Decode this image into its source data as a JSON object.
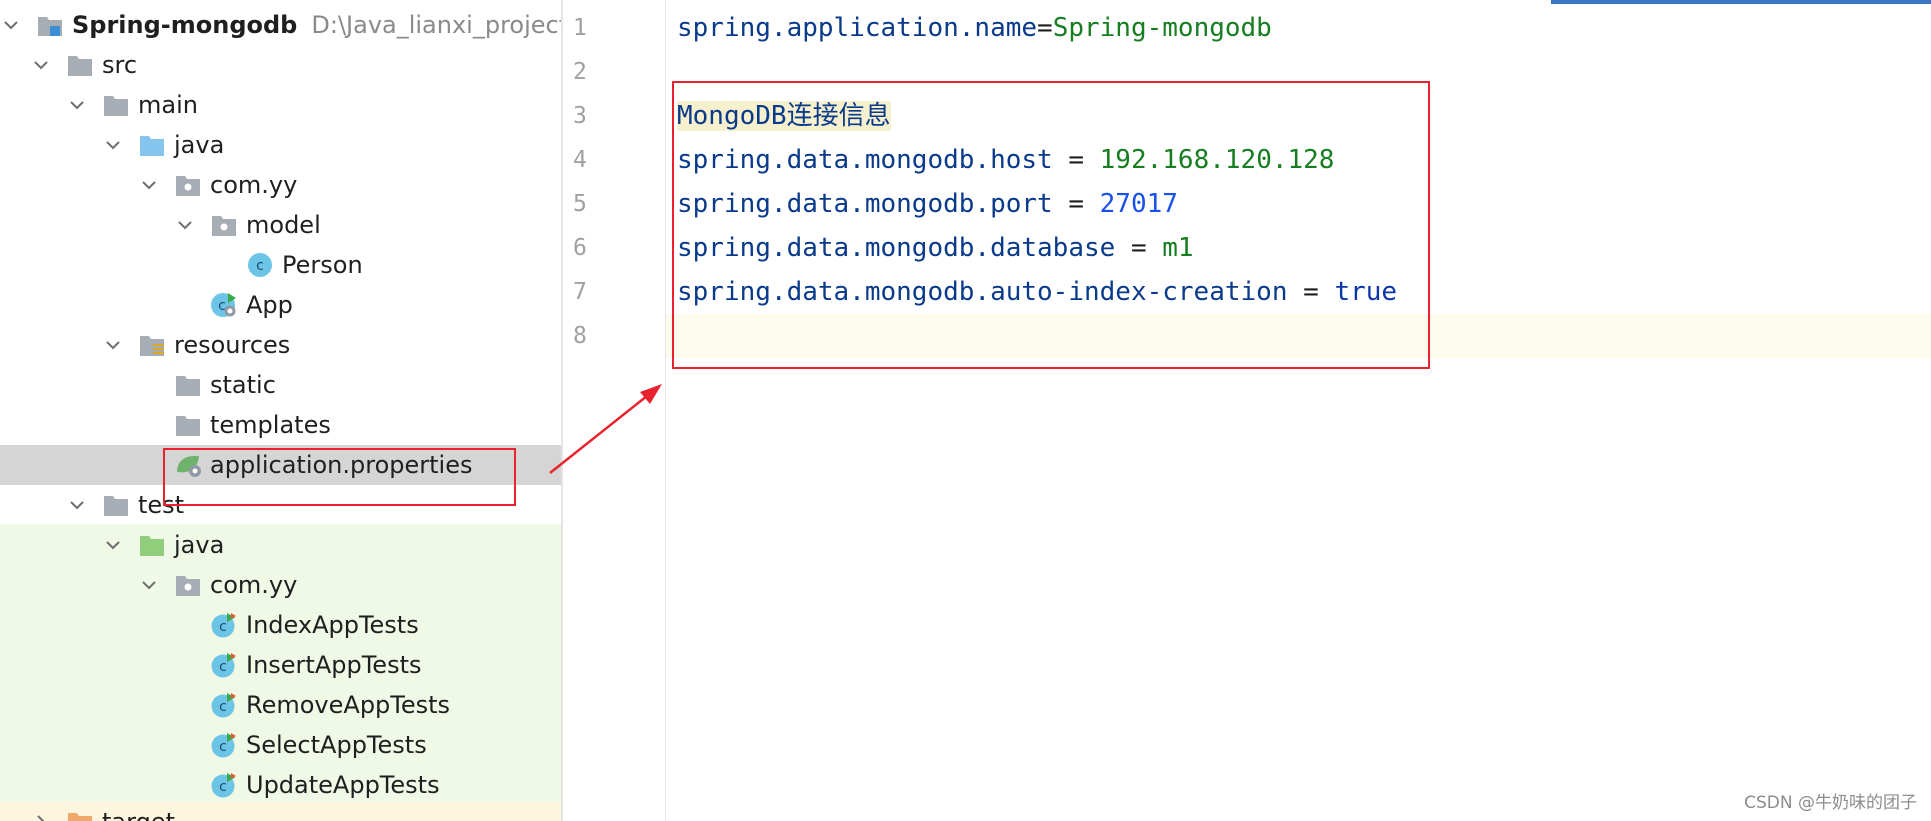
{
  "project_tree": {
    "root": {
      "label": "Spring-mongodb",
      "path": "D:\\Java_lianxi_project\\ni"
    },
    "items": [
      {
        "label": "src"
      },
      {
        "label": "main"
      },
      {
        "label": "java"
      },
      {
        "label": "com.yy"
      },
      {
        "label": "model"
      },
      {
        "label": "Person"
      },
      {
        "label": "App"
      },
      {
        "label": "resources"
      },
      {
        "label": "static"
      },
      {
        "label": "templates"
      },
      {
        "label": "application.properties"
      },
      {
        "label": "test"
      },
      {
        "label": "java"
      },
      {
        "label": "com.yy"
      },
      {
        "label": "IndexAppTests"
      },
      {
        "label": "InsertAppTests"
      },
      {
        "label": "RemoveAppTests"
      },
      {
        "label": "SelectAppTests"
      },
      {
        "label": "UpdateAppTests"
      },
      {
        "label": "target"
      }
    ]
  },
  "editor": {
    "line_numbers": [
      "1",
      "2",
      "3",
      "4",
      "5",
      "6",
      "7",
      "8"
    ],
    "lines": [
      {
        "key": "spring.application.name",
        "sep": "=",
        "value": "Spring-mongodb"
      },
      {
        "text": ""
      },
      {
        "comment": "MongoDB连接信息"
      },
      {
        "key": "spring.data.mongodb.host",
        "sep": " = ",
        "value": "192.168.120.128"
      },
      {
        "key": "spring.data.mongodb.port",
        "sep": " = ",
        "value": "27017"
      },
      {
        "key": "spring.data.mongodb.database",
        "sep": " = ",
        "value": "m1"
      },
      {
        "key": "spring.data.mongodb.auto-index-creation",
        "sep": " = ",
        "value": "true"
      },
      {
        "text": ""
      }
    ]
  },
  "watermark": "CSDN @牛奶味的团子",
  "colors": {
    "selection_bg": "#d5d5d5",
    "test_folder_bg": "#eff9e6",
    "annotation_red": "#e8232e",
    "key_color": "#0a3a8a",
    "string_value_color": "#177d21",
    "number_value_color": "#1750eb"
  },
  "icons": {
    "module": "module-folder-icon",
    "folder": "folder-icon",
    "source_root": "source-root-folder-icon",
    "test_root": "test-root-folder-icon",
    "package": "package-icon",
    "class": "java-class-icon",
    "spring_app": "spring-boot-app-icon",
    "resources": "resources-folder-icon",
    "properties": "spring-properties-icon",
    "test_class": "test-class-icon"
  }
}
